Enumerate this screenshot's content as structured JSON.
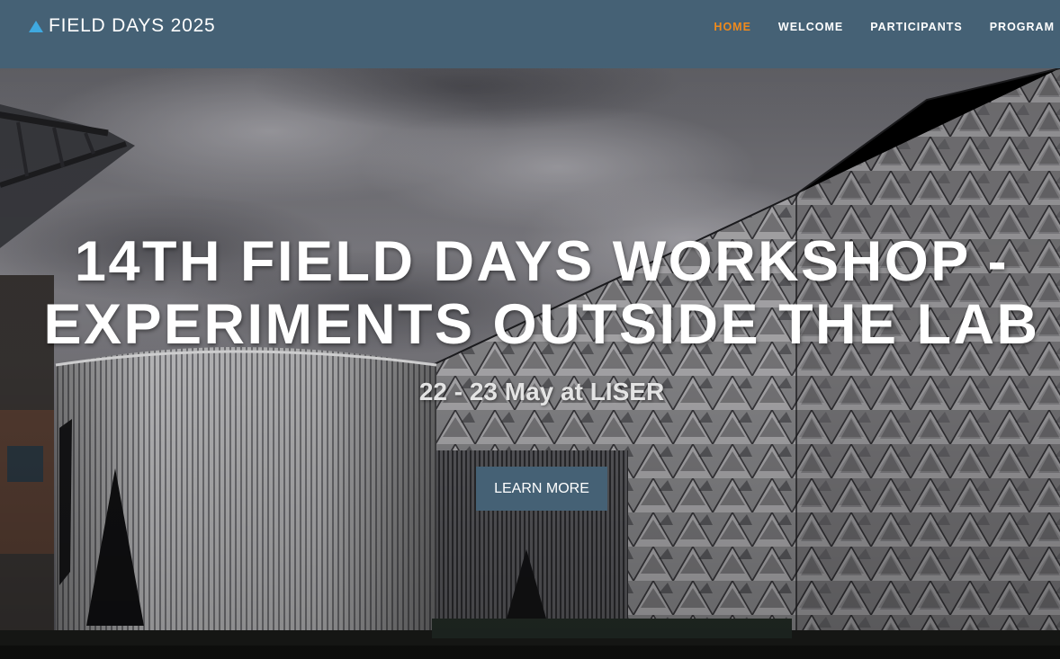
{
  "header": {
    "brand": {
      "icon": "triangle-icon",
      "label": "FIELD DAYS 2025",
      "accent_color": "#3fa9e0"
    },
    "nav": [
      {
        "label": "HOME",
        "active": true
      },
      {
        "label": "WELCOME",
        "active": false
      },
      {
        "label": "PARTICIPANTS",
        "active": false
      },
      {
        "label": "PROGRAM",
        "active": false
      }
    ],
    "background_color": "#456175",
    "active_color": "#f08a1c"
  },
  "hero": {
    "title_line1": "14TH FIELD DAYS WORKSHOP -",
    "title_line2": "EXPERIMENTS OUTSIDE THE LAB",
    "subtitle": "22 - 23 May at LISER",
    "cta_label": "LEARN MORE"
  }
}
